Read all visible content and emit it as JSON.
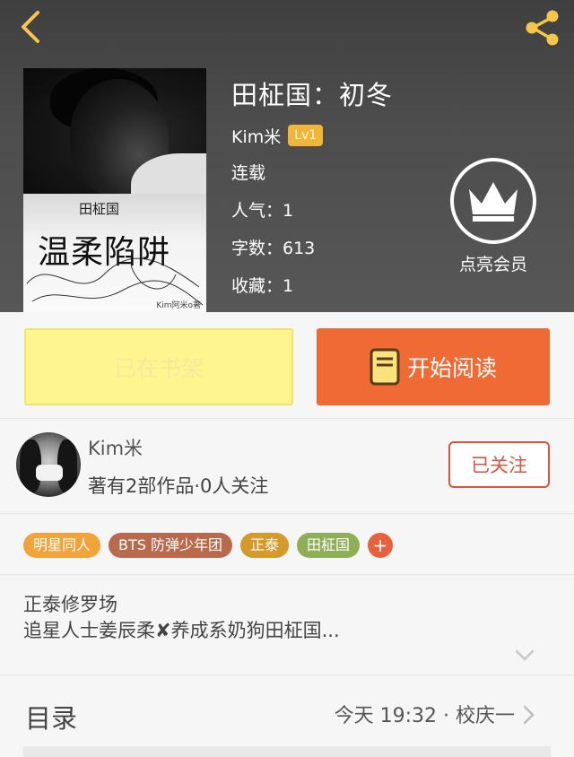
{
  "header": {
    "back_icon": "chevron-left-icon",
    "share_icon": "share-icon"
  },
  "cover": {
    "subtitle": "田柾国",
    "title": "温柔陷阱",
    "author_mark": "Kim阿米o著"
  },
  "book": {
    "title": "田柾国：初冬",
    "author": "Kim米",
    "level": "Lv1",
    "status": "连载",
    "popularity": "人气：1",
    "word_count": "字数：613",
    "favorites": "收藏：1"
  },
  "vip": {
    "icon": "crown-icon",
    "label": "点亮会员"
  },
  "actions": {
    "shelf_label": "已在书架",
    "read_label": "开始阅读",
    "read_icon": "book-icon"
  },
  "author_card": {
    "name": "Kim米",
    "stats": "著有2部作品·0人关注",
    "follow_label": "已关注"
  },
  "tags": [
    {
      "label": "明星同人",
      "color": "#f2a33a"
    },
    {
      "label": "BTS 防弹少年团",
      "color": "#b9694c"
    },
    {
      "label": "正泰",
      "color": "#d49a2c"
    },
    {
      "label": "田柾国",
      "color": "#8fae57"
    }
  ],
  "tag_add_label": "+",
  "description": {
    "line1": "正泰修罗场",
    "line2": "追星人士姜辰柔✘养成系奶狗田柾国..."
  },
  "catalog": {
    "title": "目录",
    "latest": "今天 19:32 · 校庆一"
  },
  "colors": {
    "accent_orange": "#ef6a35",
    "shelf_yellow": "#fef58e",
    "follow_red": "#d8543d",
    "level_gold": "#f1b53a"
  }
}
